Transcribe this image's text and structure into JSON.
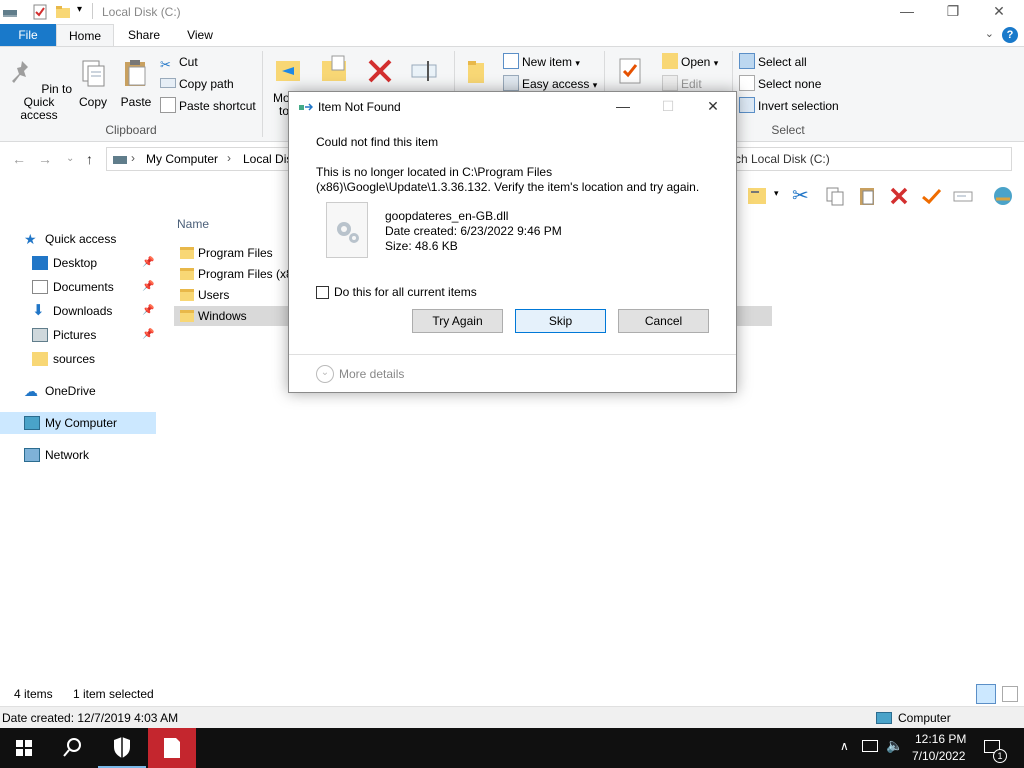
{
  "window": {
    "title": "Local Disk (C:)",
    "minimize_glyph": "—",
    "maximize_glyph": "❐",
    "close_glyph": "✕"
  },
  "ribbon_tabs": {
    "file": "File",
    "home": "Home",
    "share": "Share",
    "view": "View",
    "help_glyph": "?"
  },
  "clipboard": {
    "pin_label": "Pin to Quick access",
    "copy_label": "Copy",
    "paste_label": "Paste",
    "cut_label": "Cut",
    "copy_path_label": "Copy path",
    "paste_shortcut_label": "Paste shortcut",
    "group_label": "Clipboard"
  },
  "organize": {
    "move_label_partial": "Mo",
    "move_label_partial2": "to"
  },
  "new_group": {
    "new_item_label": "New item",
    "easy_access_label": "Easy access"
  },
  "open_group": {
    "open_label": "Open",
    "edit_label": "Edit"
  },
  "select_group": {
    "select_all": "Select all",
    "select_none": "Select none",
    "invert_selection": "Invert selection",
    "group_label": "Select"
  },
  "address": {
    "crumb_root": "My Computer",
    "crumb_current": "Local Disk",
    "search_placeholder": "ch Local Disk (C:)"
  },
  "nav_pane": {
    "quick_access": "Quick access",
    "desktop": "Desktop",
    "documents": "Documents",
    "downloads": "Downloads",
    "pictures": "Pictures",
    "sources": "sources",
    "onedrive": "OneDrive",
    "my_computer": "My Computer",
    "network": "Network"
  },
  "file_list": {
    "column_name": "Name",
    "rows": [
      "Program Files",
      "Program Files (x8",
      "Users",
      "Windows"
    ]
  },
  "status": {
    "item_count": "4 items",
    "selected": "1 item selected",
    "date_created": "Date created: 12/7/2019 4:03 AM",
    "location": "Computer"
  },
  "taskbar": {
    "time": "12:16 PM",
    "date": "7/10/2022",
    "notification_count": "1"
  },
  "dialog": {
    "title": "Item Not Found",
    "heading": "Could not find this item",
    "message": "This is no longer located in C:\\Program Files (x86)\\Google\\Update\\1.3.36.132. Verify the item's location and try again.",
    "file_name": "goopdateres_en-GB.dll",
    "date_created": "Date created: 6/23/2022 9:46 PM",
    "size": "Size: 48.6 KB",
    "checkbox_label": "Do this for all current items",
    "try_again": "Try Again",
    "skip": "Skip",
    "cancel": "Cancel",
    "more_details": "More details",
    "minimize_glyph": "—",
    "maximize_glyph": "☐",
    "close_glyph": "✕"
  },
  "colors": {
    "accent": "#1979ca",
    "selection": "#cce8ff",
    "taskbar": "#101010",
    "folder": "#f8d775"
  }
}
